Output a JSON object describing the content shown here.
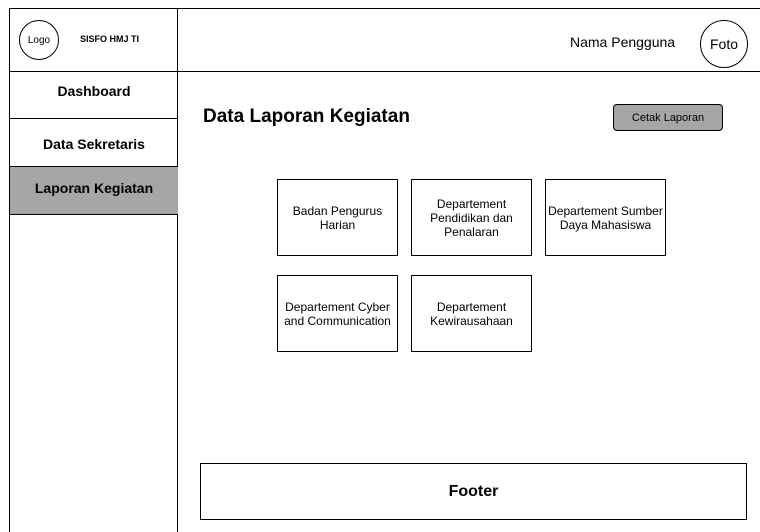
{
  "brand": {
    "logo_text": "Logo",
    "app_name": "SISFO HMJ TI"
  },
  "sidebar": {
    "items": [
      {
        "label": "Dashboard"
      },
      {
        "label": "Data Sekretaris"
      },
      {
        "label": "Laporan Kegiatan",
        "active": true
      }
    ]
  },
  "header": {
    "user_name": "Nama Pengguna",
    "avatar_text": "Foto"
  },
  "main": {
    "title": "Data Laporan Kegiatan",
    "print_button": "Cetak Laporan",
    "cards": [
      {
        "label": "Badan Pengurus Harian"
      },
      {
        "label": "Departement Pendidikan dan Penalaran"
      },
      {
        "label": "Departement Sumber Daya Mahasiswa"
      },
      {
        "label": "Departement Cyber and Communication"
      },
      {
        "label": "Departement Kewirausahaan"
      }
    ]
  },
  "footer": {
    "label": "Footer"
  },
  "colors": {
    "active_nav": "#a6a6a6",
    "button_bg": "#a6a6a6",
    "border": "#000000"
  }
}
